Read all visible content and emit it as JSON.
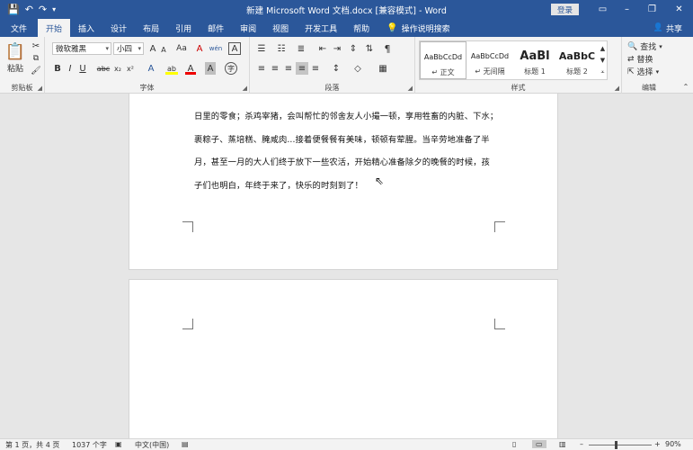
{
  "titlebar": {
    "title": "新建 Microsoft Word 文档.docx [兼容模式] - Word",
    "login": "登录",
    "minimize": "–",
    "restore": "❐",
    "close": "✕"
  },
  "tabs": [
    "文件",
    "开始",
    "插入",
    "设计",
    "布局",
    "引用",
    "邮件",
    "审阅",
    "视图",
    "开发工具",
    "帮助"
  ],
  "tell_me": "操作说明搜索",
  "share": "共享",
  "ribbon": {
    "clipboard": {
      "label": "剪贴板",
      "paste": "粘贴"
    },
    "font": {
      "label": "字体",
      "font_name": "微软雅黑",
      "font_size": "小四",
      "grow": "A",
      "shrink": "A",
      "case": "Aa",
      "clear": "A",
      "pinyin": "wén",
      "border_char": "A",
      "bold": "B",
      "italic": "I",
      "underline": "U",
      "strike": "abc",
      "sub": "x₂",
      "sup": "x²",
      "effects": "A",
      "highlight": "ab",
      "color": "A",
      "shade": "A",
      "circle": "字"
    },
    "paragraph": {
      "label": "段落"
    },
    "styles": {
      "label": "样式",
      "items": [
        {
          "preview": "AaBbCcDd",
          "name": "↵ 正文"
        },
        {
          "preview": "AaBbCcDd",
          "name": "↵ 无间隔"
        },
        {
          "preview": "AaBl",
          "name": "标题 1"
        },
        {
          "preview": "AaBbC",
          "name": "标题 2"
        }
      ]
    },
    "editing": {
      "label": "编辑",
      "find": "查找",
      "replace": "替换",
      "select": "选择"
    }
  },
  "document": {
    "lines": [
      "日里的零食；杀鸡宰猪，会叫帮忙的邻舍友人小撮一顿，享用牲畜的内脏、下水；",
      "裹粽子、蒸培糕、腌咸肉...接着便餐餐有美味，顿顿有荤腥。当辛劳地准备了半",
      "月，甚至一月的大人们终于放下一些农活，开始精心准备除夕的晚餐的时候，孩",
      "子们也明白，年终于来了，快乐的时刻到了！"
    ]
  },
  "status": {
    "page": "第 1 页，共 4 页",
    "words": "1037 个字",
    "lang": "中文(中国)",
    "zoom": "90%",
    "minus": "–",
    "plus": "+"
  }
}
